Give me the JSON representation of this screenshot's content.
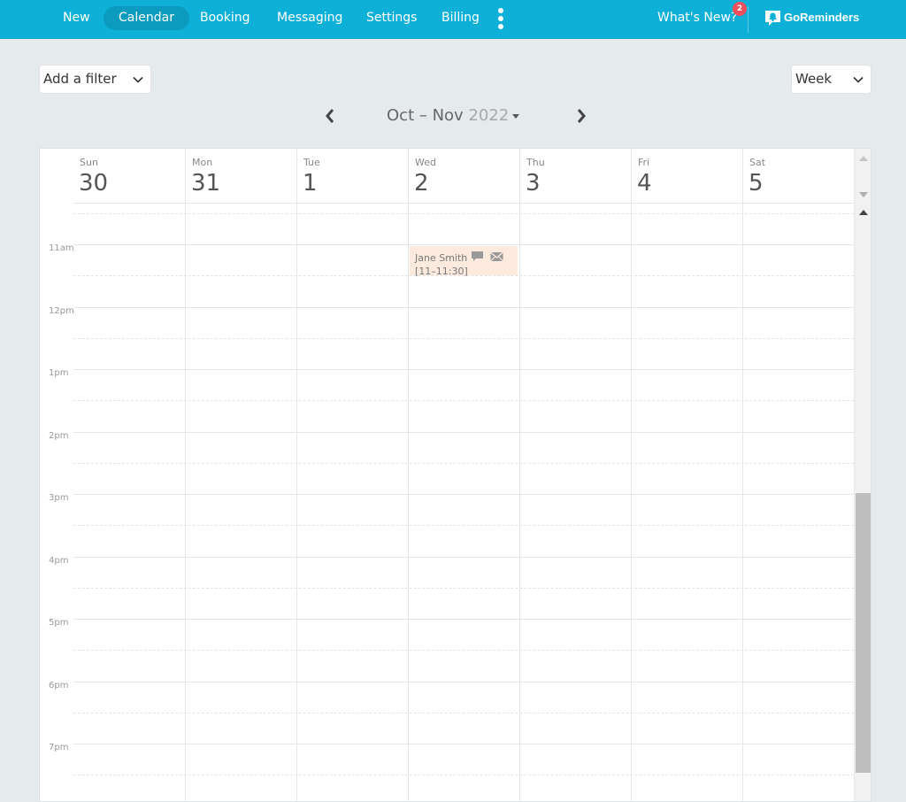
{
  "nav": {
    "items": [
      {
        "label": "New",
        "active": false
      },
      {
        "label": "Calendar",
        "active": true
      },
      {
        "label": "Booking",
        "active": false
      },
      {
        "label": "Messaging",
        "active": false
      },
      {
        "label": "Settings",
        "active": false
      },
      {
        "label": "Billing",
        "active": false
      }
    ],
    "more_icon": "kebab-vertical-icon",
    "whats_new_label": "What's New?",
    "whats_new_badge": "2",
    "brand_label": "GoReminders",
    "brand_icon": "bell-chat-icon"
  },
  "toolbar": {
    "filter_select": "Add a filter",
    "view_select": "Week",
    "range_month": "Oct – Nov",
    "range_year": "2022",
    "prev_icon": "chevron-left-icon",
    "next_icon": "chevron-right-icon"
  },
  "calendar": {
    "days": [
      {
        "name": "Sun",
        "num": "30"
      },
      {
        "name": "Mon",
        "num": "31"
      },
      {
        "name": "Tue",
        "num": "1"
      },
      {
        "name": "Wed",
        "num": "2"
      },
      {
        "name": "Thu",
        "num": "3"
      },
      {
        "name": "Fri",
        "num": "4"
      },
      {
        "name": "Sat",
        "num": "5"
      }
    ],
    "hours": [
      "11am",
      "12pm",
      "1pm",
      "2pm",
      "3pm",
      "4pm",
      "5pm",
      "6pm",
      "7pm"
    ],
    "events": [
      {
        "title": "Jane Smith",
        "time": "[11–11:30]",
        "day": "Wed",
        "icons": [
          "chat-icon",
          "mail-icon"
        ],
        "color": "#fdeadf"
      }
    ]
  },
  "colors": {
    "nav_bg": "#0fb0d8",
    "nav_active": "#0a9bbf",
    "badge": "#ef4f5a",
    "page_bg": "#e5eaed",
    "event_bg": "#fdeadf"
  }
}
